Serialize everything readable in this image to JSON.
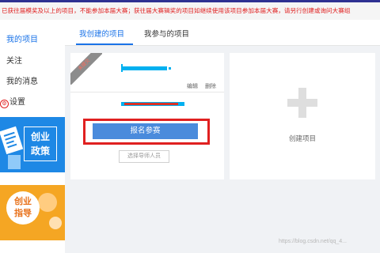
{
  "notice": "已获往届模奖及以上的项目，不能参加本届大赛；获往届大赛辑奖的项目如继续使用该项目参加本届大赛，请另行创建或询问大赛组",
  "sidebar": {
    "items": [
      {
        "label": "我的项目"
      },
      {
        "label": "关注"
      },
      {
        "label": "我的消息"
      },
      {
        "label": "设置"
      }
    ]
  },
  "promos": [
    {
      "title": "创业政策",
      "line1": "创业",
      "line2": "政策",
      "color": "#1e88e5"
    },
    {
      "title": "创业指导",
      "line1": "创业",
      "line2": "指导",
      "color": "#f5a623"
    }
  ],
  "tabs": [
    {
      "label": "我创建的项目",
      "active": true
    },
    {
      "label": "我参与的项目",
      "active": false
    }
  ],
  "project_card": {
    "ribbon_label": "未提交",
    "edit_label": "编辑",
    "delete_label": "删除",
    "signup_button": "报名参赛",
    "choose_mentor_button": "选择导师人员"
  },
  "create_card": {
    "label": "创建项目"
  },
  "watermark": "https://blog.csdn.net/qq_4..."
}
